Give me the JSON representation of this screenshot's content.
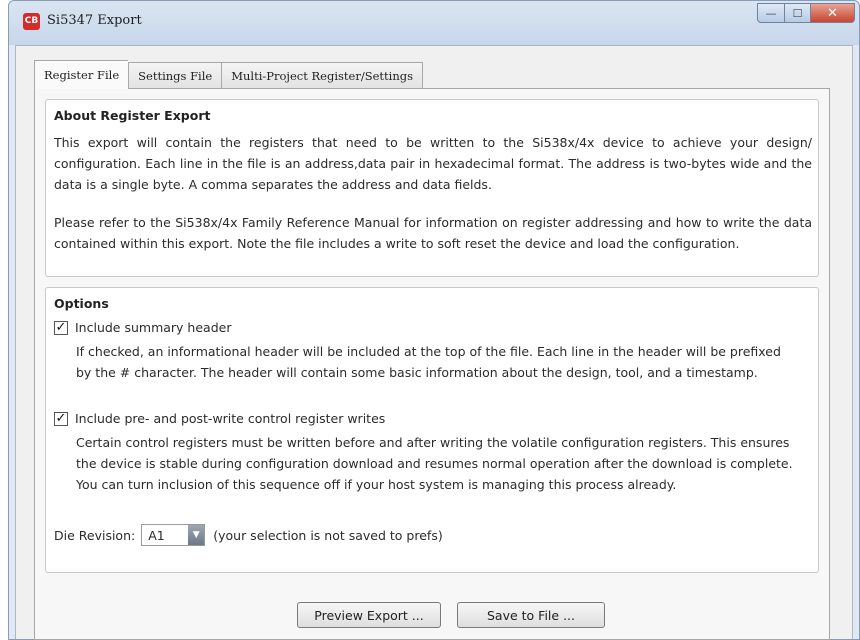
{
  "window": {
    "title": "Si5347 Export",
    "app_icon_text": "CB",
    "buttons": {
      "minimize": "—",
      "maximize": "☐",
      "close": "✕"
    }
  },
  "tabs": [
    {
      "label": "Register File",
      "active": true
    },
    {
      "label": "Settings File",
      "active": false
    },
    {
      "label": "Multi-Project Register/Settings",
      "active": false
    }
  ],
  "about": {
    "title": "About Register Export",
    "paragraph1": "This export will contain the registers that need to be written to the Si538x/4x device to achieve your design/ configuration. Each line in the file is an address,data pair in hexadecimal format. The address is two-bytes wide and the data is a single byte. A comma separates the address and data fields.",
    "paragraph2": "Please refer to the Si538x/4x Family Reference Manual for information on register addressing and how to write the data contained within this export. Note the file includes a write to soft reset the device and load the configuration."
  },
  "options": {
    "title": "Options",
    "summary_header": {
      "label": "Include summary header",
      "checked": true,
      "description": "If checked, an informational header will be included at the top of the file. Each line in the header will be prefixed by the # character. The header will contain some basic information about the design, tool, and a timestamp."
    },
    "pre_post_writes": {
      "label": "Include pre- and post-write control register writes",
      "checked": true,
      "description": "Certain control registers must be written before and after writing the volatile configuration registers. This ensures the device is stable during configuration download and resumes normal operation after the download is complete. You can turn inclusion of this sequence off if your host system is managing this process already."
    },
    "die_revision": {
      "label": "Die Revision:",
      "value": "A1",
      "note": "(your selection is not saved to prefs)"
    }
  },
  "footer": {
    "preview_label": "Preview Export ...",
    "save_label": "Save to File ..."
  },
  "check_glyph": "✓"
}
